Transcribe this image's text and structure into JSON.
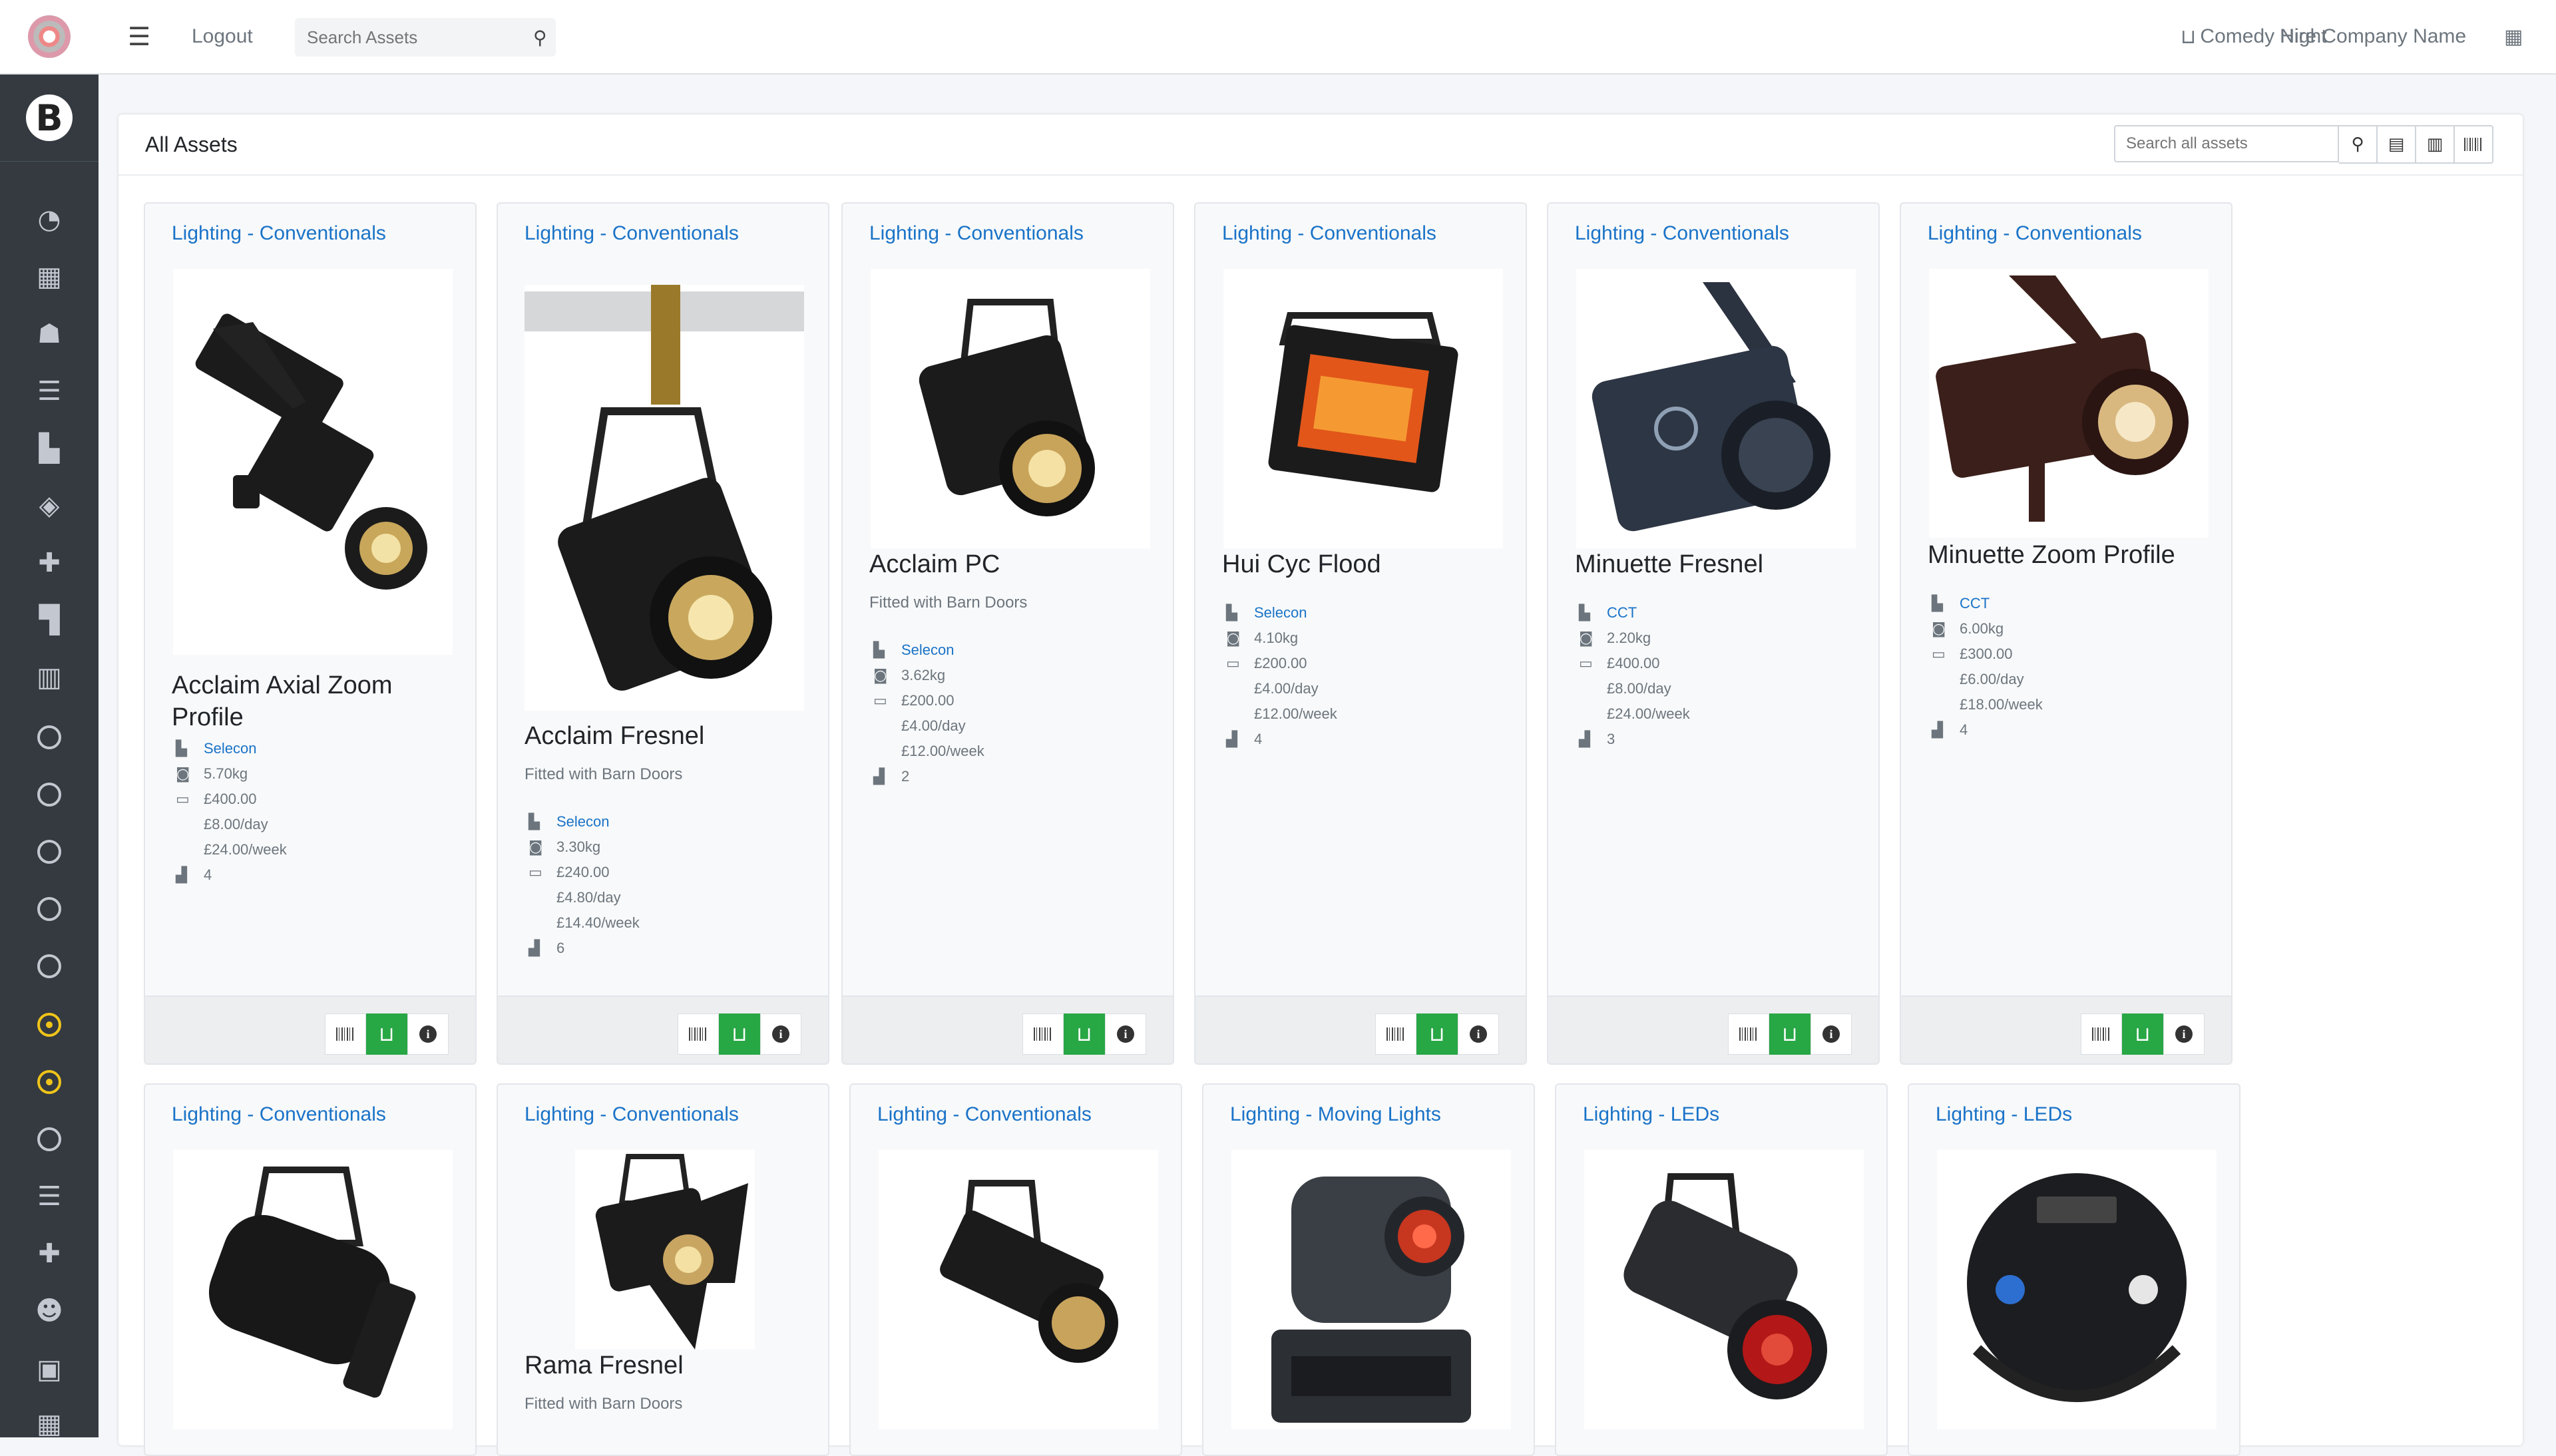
{
  "topbar": {
    "logout_label": "Logout",
    "search_placeholder": "Search Assets",
    "project_label": "Comedy Night",
    "company_label": "Hire Company Name"
  },
  "sidebar": {
    "brand_letter": "B",
    "icons": [
      "dashboard-icon",
      "building-icon",
      "warehouse-icon",
      "list-icon",
      "industry-icon",
      "layers-icon",
      "plus-icon",
      "paint-roller-icon",
      "barcode-icon",
      "circle-icon",
      "circle-icon",
      "circle-icon",
      "circle-icon",
      "circle-icon",
      "circle-dot-icon",
      "circle-dot-icon",
      "circle-icon",
      "ordered-list-icon",
      "plus-icon",
      "users-icon",
      "unlock-icon",
      "city-icon"
    ]
  },
  "main": {
    "title": "All Assets",
    "search_placeholder": "Search all assets"
  },
  "assets": [
    {
      "category": "Lighting - Conventionals",
      "name": "Acclaim Axial Zoom Profile",
      "subtitle": "",
      "manufacturer": "Selecon",
      "weight": "5.70kg",
      "value": "£400.00",
      "day": "£8.00/day",
      "week": "£24.00/week",
      "quantity": "4"
    },
    {
      "category": "Lighting - Conventionals",
      "name": "Acclaim Fresnel",
      "subtitle": "Fitted with Barn Doors",
      "manufacturer": "Selecon",
      "weight": "3.30kg",
      "value": "£240.00",
      "day": "£4.80/day",
      "week": "£14.40/week",
      "quantity": "6"
    },
    {
      "category": "Lighting - Conventionals",
      "name": "Acclaim PC",
      "subtitle": "Fitted with Barn Doors",
      "manufacturer": "Selecon",
      "weight": "3.62kg",
      "value": "£200.00",
      "day": "£4.00/day",
      "week": "£12.00/week",
      "quantity": "2"
    },
    {
      "category": "Lighting - Conventionals",
      "name": "Hui Cyc Flood",
      "subtitle": "",
      "manufacturer": "Selecon",
      "weight": "4.10kg",
      "value": "£200.00",
      "day": "£4.00/day",
      "week": "£12.00/week",
      "quantity": "4"
    },
    {
      "category": "Lighting - Conventionals",
      "name": "Minuette Fresnel",
      "subtitle": "",
      "manufacturer": "CCT",
      "weight": "2.20kg",
      "value": "£400.00",
      "day": "£8.00/day",
      "week": "£24.00/week",
      "quantity": "3"
    },
    {
      "category": "Lighting - Conventionals",
      "name": "Minuette Zoom Profile",
      "subtitle": "",
      "manufacturer": "CCT",
      "weight": "6.00kg",
      "value": "£300.00",
      "day": "£6.00/day",
      "week": "£18.00/week",
      "quantity": "4"
    }
  ],
  "assets_row2": [
    {
      "category": "Lighting - Conventionals",
      "name": "",
      "subtitle": ""
    },
    {
      "category": "Lighting - Conventionals",
      "name": "Rama Fresnel",
      "subtitle": "Fitted with Barn Doors"
    },
    {
      "category": "Lighting - Conventionals",
      "name": "",
      "subtitle": ""
    },
    {
      "category": "Lighting - Moving Lights",
      "name": "",
      "subtitle": ""
    },
    {
      "category": "Lighting - LEDs",
      "name": "",
      "subtitle": ""
    },
    {
      "category": "Lighting - LEDs",
      "name": "",
      "subtitle": ""
    }
  ]
}
